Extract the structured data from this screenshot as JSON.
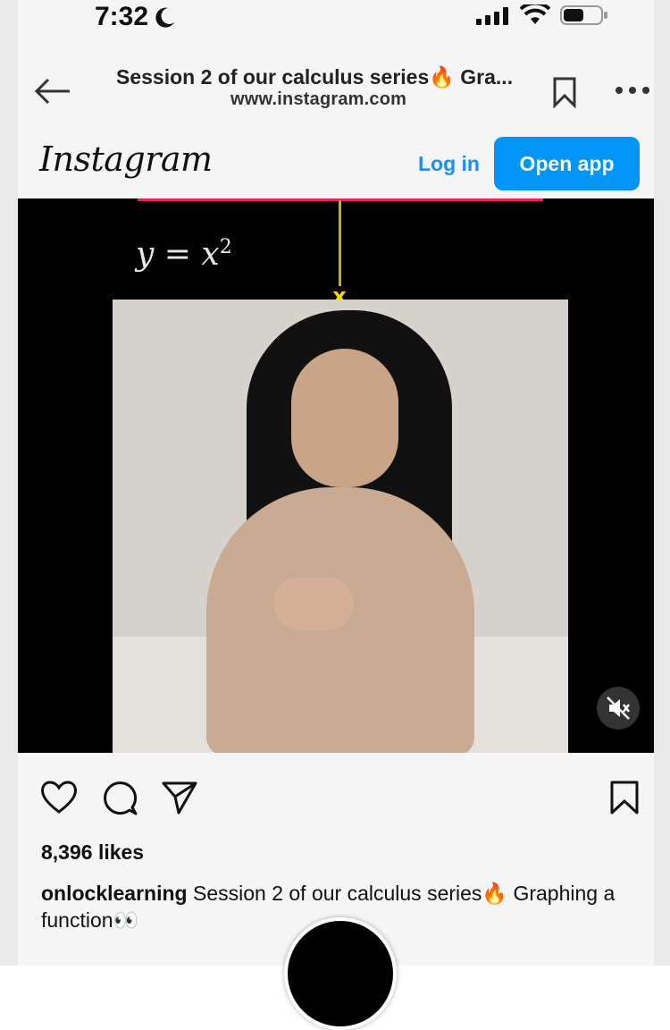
{
  "status_bar": {
    "time": "7:32"
  },
  "browser": {
    "page_title": "Session 2 of our calculus series🔥 Gra...",
    "url": "www.instagram.com"
  },
  "instagram": {
    "logo_text": "Instagram",
    "login_label": "Log in",
    "open_app_label": "Open app"
  },
  "video": {
    "formula_base": "y = x",
    "formula_exponent": "2",
    "marker_label": "x"
  },
  "post": {
    "likes": "8,396 likes",
    "username": "onlocklearning",
    "caption_text": " Session 2 of our calculus series🔥 Graphing a function👀"
  },
  "colors": {
    "primary_button": "#0095f6",
    "link_blue": "#1b8ef2",
    "axis_pink": "#e0245e",
    "marker_yellow": "#ffd800"
  },
  "icons": [
    "moon-icon",
    "cellular-signal-icon",
    "wifi-icon",
    "battery-icon",
    "back-arrow-icon",
    "bookmark-icon",
    "more-icon",
    "mute-icon",
    "heart-icon",
    "comment-icon",
    "share-icon",
    "save-icon"
  ]
}
